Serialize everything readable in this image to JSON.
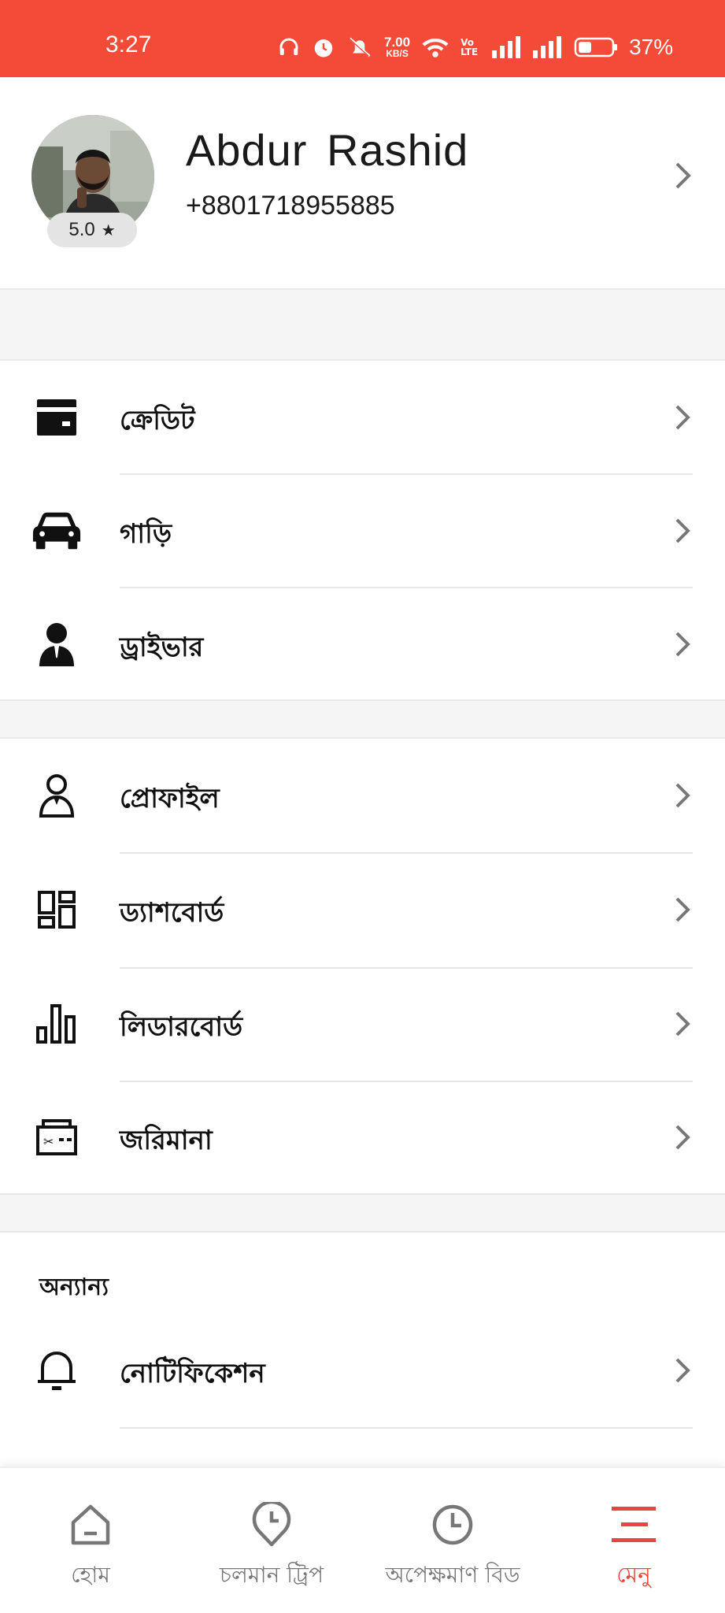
{
  "status_bar": {
    "time": "3:27",
    "speed_value": "7.00",
    "speed_unit": "KB/S",
    "volte": "Vo LTE",
    "battery_percent": "37%",
    "icons": [
      "headphones-icon",
      "alarm-icon",
      "mute-icon",
      "wifi-icon",
      "signal-icon",
      "battery-icon"
    ]
  },
  "profile": {
    "name": "Abdur Rashid",
    "phone": "+8801718955885",
    "rating": "5.0",
    "rating_icon": "★"
  },
  "menu_group_1": [
    {
      "label": "ক্রেডিট",
      "icon": "wallet-icon"
    },
    {
      "label": "গাড়ি",
      "icon": "car-icon"
    },
    {
      "label": "ড্রাইভার",
      "icon": "driver-icon"
    }
  ],
  "menu_group_2": [
    {
      "label": "প্রোফাইল",
      "icon": "person-icon"
    },
    {
      "label": "ড্যাশবোর্ড",
      "icon": "dashboard-icon"
    },
    {
      "label": "লিডারবোর্ড",
      "icon": "bar-chart-icon"
    },
    {
      "label": "জরিমানা",
      "icon": "fine-ticket-icon"
    }
  ],
  "others_section": {
    "title": "অন্যান্য",
    "items": [
      {
        "label": "নোটিফিকেশন",
        "icon": "bell-icon"
      }
    ]
  },
  "bottom_nav": [
    {
      "label": "হোম",
      "icon": "home-icon",
      "active": false
    },
    {
      "label": "চলমান ট্রিপ",
      "icon": "location-clock-icon",
      "active": false
    },
    {
      "label": "অপেক্ষমাণ বিড",
      "icon": "clock-icon",
      "active": false
    },
    {
      "label": "মেনু",
      "icon": "menu-icon",
      "active": true
    }
  ],
  "colors": {
    "brand": "#f44a38",
    "active_nav": "#e8473a",
    "inactive_nav": "#777777",
    "section_gap": "#f5f5f5"
  }
}
